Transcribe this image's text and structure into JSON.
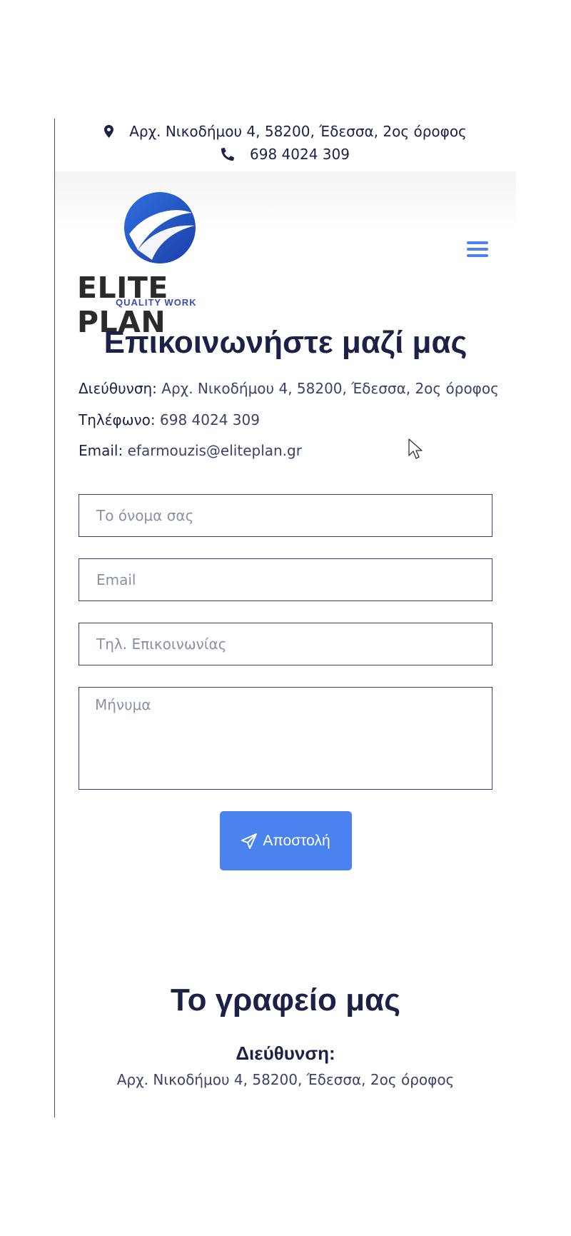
{
  "topbar": {
    "address": "Αρχ. Νικοδήμου 4, 58200, Έδεσσα, 2ος όροφος",
    "phone": "698 4024 309",
    "icons": [
      "map-pin-icon",
      "phone-icon"
    ]
  },
  "logo": {
    "brand": "ELITE PLAN",
    "tagline": "QUALITY WORK"
  },
  "nav": {
    "menu_icon": "hamburger-menu-icon"
  },
  "contact": {
    "title": "Επικοινωνήστε μαζί μας",
    "address_label": "Διεύθυνση:",
    "address_value": "Αρχ. Νικοδήμου 4, 58200, Έδεσσα, 2ος όροφος",
    "phone_label": "Τηλέφωνο:",
    "phone_value": "698 4024 309",
    "email_label": "Email:",
    "email_value": "efarmouzis@eliteplan.gr"
  },
  "form": {
    "name_placeholder": "Το όνομα σας",
    "email_placeholder": "Email",
    "phone_placeholder": "Τηλ. Επικοινωνίας",
    "message_placeholder": "Μήνυμα",
    "submit_label": "Αποστολή"
  },
  "office": {
    "title": "Το γραφείο μας",
    "subtitle": "Διεύθυνση:",
    "address": "Αρχ. Νικοδήμου 4, 58200, Έδεσσα, 2ος όροφος"
  },
  "colors": {
    "accent": "#4a82f0",
    "heading": "#1b2147",
    "text": "#3c4268"
  }
}
